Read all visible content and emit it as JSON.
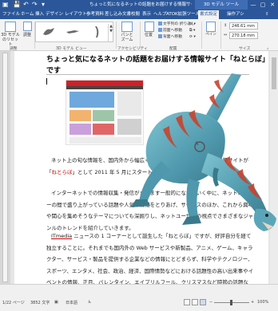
{
  "titlebar": {
    "doc_title": "ちょっと気になるネットの話題をお届けする情報サイト・",
    "context_title": "3D モデル ツール",
    "minimize": "—",
    "restore": "▢",
    "close": "✕"
  },
  "tabs": [
    "ファイル",
    "ホーム",
    "挿入",
    "デザイン",
    "レイアウト",
    "参考資料",
    "差し込み文書",
    "校閲",
    "表示",
    "ヘルプ",
    "ATOK拡張ツール",
    "書式設定",
    "操作アシ"
  ],
  "active_tab_index": 11,
  "ribbon": {
    "btn_3d_reset": "3D モデル\nのリセット",
    "btn_tone": "調整",
    "gallery_group": "3D モデル ビュー",
    "btn_panzoom": "パンと\nズーム",
    "group_adjust": "調整",
    "btn_position": "位置",
    "btn_wrap": "文字列の\n折り返し",
    "btn_front": "前面へ移動",
    "btn_back": "背面へ移動",
    "btn_selpane": "オブジェクトの選択と表示",
    "group_arrange": "配置",
    "size_height": "246.61 mm",
    "size_width": "270.18 mm",
    "group_size": "サイズ",
    "accessibility": "アクセシビリティ"
  },
  "document": {
    "title_line1": "ちょっと気になるネットの話題をお届けする情報サイト「ねとらぼ」",
    "title_line2": "です",
    "para1": "ネット上の旬な情報を、国内外から幅広く集め、わかりやすく紹介する情報サイトが「ねとらぼ」として 2011 年 5 月にスタートしました。",
    "para1_link": "ねとらぼ",
    "para2": "インターネットでの情報収集・発信がますます一般的になっていく中に、ネットユーザーの間で盛り上がっている話題や人気の情報をとりあげ、サービスのほか、これから興味や関心を集めそうなテーマについても深掘りし、ネットユーザーの視点でさまざまなジャンルのトレンドを紹介していきます。",
    "para3_link": "ITmedia",
    "para3": " ニュースの 1 コーナーとして誕生した「ねとらぼ」ですが、好評自分を経て独立することに。それまでも国内外の Web サービスや新製品、アニメ、ゲーム、キャラクター、サービス・製品を提供する企業などの情報にとどまらず、科学やテクノロジー、スポーツ、エンタメ、社会、政治、経済、国際情勢などにおける話題性の高い出来事やイベントの情報、正月、バレンタイン、エイプリルフール、クリスマスなど時節の話題など、ネット上での反応や IT 業界の動向を交えて紹介していきます。"
  },
  "statusbar": {
    "page": "1/22 ページ",
    "words": "3852 文字",
    "lang": "日本語",
    "zoom": "100%"
  },
  "colors": {
    "accent": "#2b579a",
    "dino_body": "#5aa6b8",
    "dino_stripe": "#c8442e"
  }
}
